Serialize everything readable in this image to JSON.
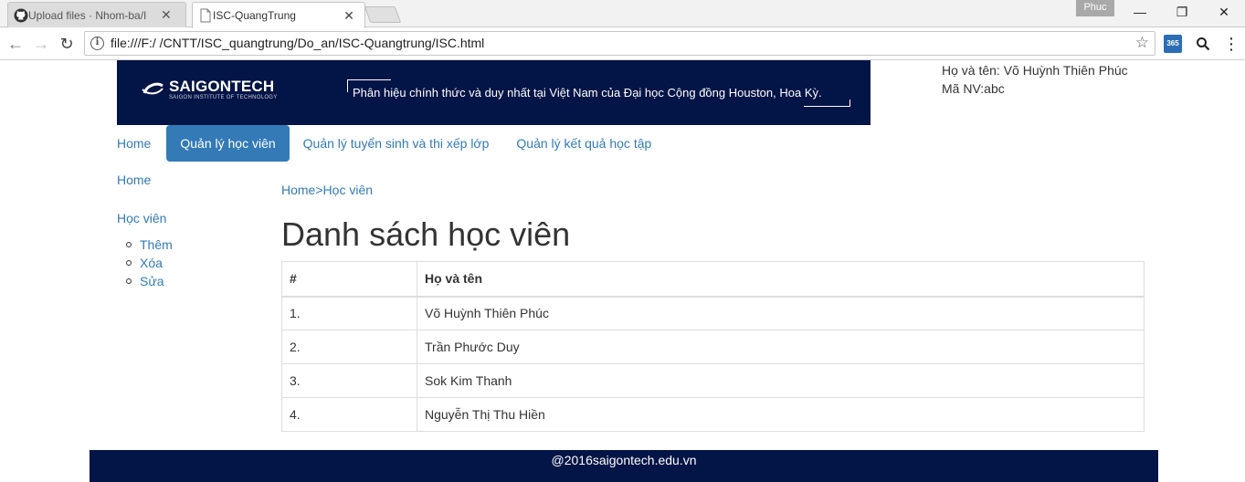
{
  "browser": {
    "tabs": [
      {
        "title": "Upload files · Nhom-ba/I",
        "icon": "github-icon",
        "active": false
      },
      {
        "title": "ISC-QuangTrung",
        "icon": "page-icon",
        "active": true
      }
    ],
    "profile": "Phuc",
    "url": "file:///F:/ /CNTT/ISC_quangtrung/Do_an/ISC-Quangtrung/ISC.html",
    "close_glyph": "✕",
    "minimize_glyph": "—",
    "restore_glyph": "❐",
    "menu_glyph": "⋮",
    "ext_label": "365"
  },
  "header": {
    "logo_text": "SAIGONTECH",
    "logo_sub": "SAIGON INSTITUTE OF TECHNOLOGY",
    "tagline": "Phân hiệu chính thức và duy nhất tại Việt Nam của Đại học Cộng đồng Houston, Hoa Kỳ.",
    "brand_color": "#031446"
  },
  "user": {
    "name_line": "Họ và tên: Võ Huỳnh Thiên Phúc",
    "id_line": "Mã NV:abc"
  },
  "nav": {
    "items": [
      {
        "label": "Home",
        "active": false
      },
      {
        "label": "Quản lý học viên",
        "active": true
      },
      {
        "label": "Quản lý tuyển sinh và thi xếp lớp",
        "active": false
      },
      {
        "label": "Quản lý kết quả học tập",
        "active": false
      }
    ],
    "accent_color": "#337ab7"
  },
  "sidebar": {
    "home": "Home",
    "section": "Học viên",
    "items": [
      "Thêm",
      "Xóa",
      "Sửa"
    ]
  },
  "breadcrumb": {
    "home": "Home",
    "separator": ">",
    "current": "Học viên"
  },
  "page": {
    "title": "Danh sách học viên"
  },
  "table": {
    "headers": [
      "#",
      "Họ và tên"
    ],
    "rows": [
      [
        "1.",
        "Võ Huỳnh Thiên Phúc"
      ],
      [
        "2.",
        "Trần Phước Duy"
      ],
      [
        "3.",
        "Sok Kim Thanh"
      ],
      [
        "4.",
        "Nguyễn Thị Thu Hiền"
      ]
    ]
  },
  "footer": {
    "text": "@2016saigontech.edu.vn"
  }
}
